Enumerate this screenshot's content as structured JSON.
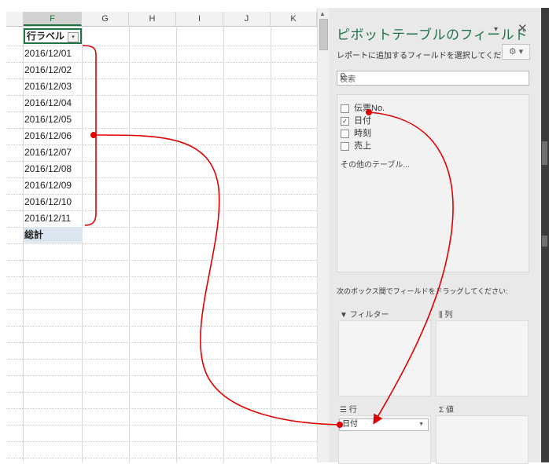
{
  "sheet": {
    "columns": [
      "F",
      "G",
      "H",
      "I",
      "J",
      "K"
    ],
    "selected_column": "F",
    "row_label_header": "行ラベル",
    "filter_glyph": "▾",
    "dates": [
      "2016/12/01",
      "2016/12/02",
      "2016/12/03",
      "2016/12/04",
      "2016/12/05",
      "2016/12/06",
      "2016/12/07",
      "2016/12/08",
      "2016/12/09",
      "2016/12/10",
      "2016/12/11"
    ],
    "total_label": "総計"
  },
  "pivot_pane": {
    "title": "ピボットテーブルのフィールド",
    "title_dropdown_glyph": "▾",
    "close_glyph": "✕",
    "subtitle": "レポートに追加するフィールドを選択してください:",
    "settings_glyph": "⚙ ▾",
    "search_placeholder": "検索",
    "fields": [
      {
        "label": "伝票No.",
        "checked": false
      },
      {
        "label": "日付",
        "checked": true
      },
      {
        "label": "時刻",
        "checked": false
      },
      {
        "label": "売上",
        "checked": false
      }
    ],
    "other_tables": "その他のテーブル...",
    "drag_instruction": "次のボックス間でフィールドをドラッグしてください:",
    "areas": {
      "filter": "フィルター",
      "columns": "列",
      "rows": "行",
      "values": "値"
    },
    "rows_item": "日付"
  },
  "colors": {
    "accent": "#217346",
    "annotation": "#e00000",
    "total_fill": "#dce6f1"
  }
}
